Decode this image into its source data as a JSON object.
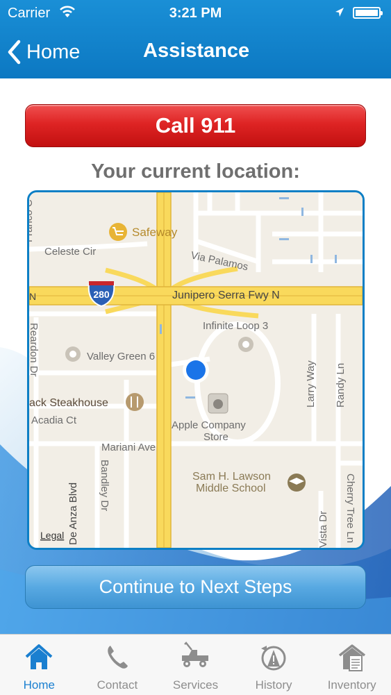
{
  "status_bar": {
    "carrier": "Carrier",
    "time": "3:21 PM"
  },
  "nav": {
    "back_label": "Home",
    "title": "Assistance"
  },
  "call_button": {
    "label": "Call 911"
  },
  "location_label": "Your current location:",
  "map": {
    "legal": "Legal",
    "highway_shield": "280",
    "labels": {
      "franco": "Franco C",
      "safeway": "Safeway",
      "celeste": "Celeste Cir",
      "via_palamos": "Via Palamos",
      "n_280": "N",
      "junipero": "Junipero Serra Fwy N",
      "infinite_loop": "Infinite Loop 3",
      "valley_green": "Valley Green 6",
      "reardon": "Reardon Dr",
      "larry": "Larry Way",
      "randy": "Randy Ln",
      "steakhouse": "ack Steakhouse",
      "acadia": "Acadia Ct",
      "apple_store_1": "Apple Company",
      "apple_store_2": "Store",
      "mariani": "Mariani Ave",
      "bandley": "Bandley Dr",
      "de_anza": "N De Anza Blvd",
      "lawson_1": "Sam H. Lawson",
      "lawson_2": "Middle School",
      "vista": "Vista Dr",
      "cherry": "Cherry Tree Ln"
    }
  },
  "next_button": {
    "label": "Continue to Next Steps"
  },
  "tabs": [
    {
      "label": "Home",
      "icon": "home-icon",
      "active": true
    },
    {
      "label": "Contact",
      "icon": "phone-icon",
      "active": false
    },
    {
      "label": "Services",
      "icon": "tow-truck-icon",
      "active": false
    },
    {
      "label": "History",
      "icon": "history-icon",
      "active": false
    },
    {
      "label": "Inventory",
      "icon": "inventory-icon",
      "active": false
    }
  ],
  "colors": {
    "nav_blue": "#0c78c2",
    "call_red": "#de2424",
    "next_blue": "#58a9e2",
    "tab_active": "#1a7fd0",
    "location_dot": "#1a74e8"
  }
}
